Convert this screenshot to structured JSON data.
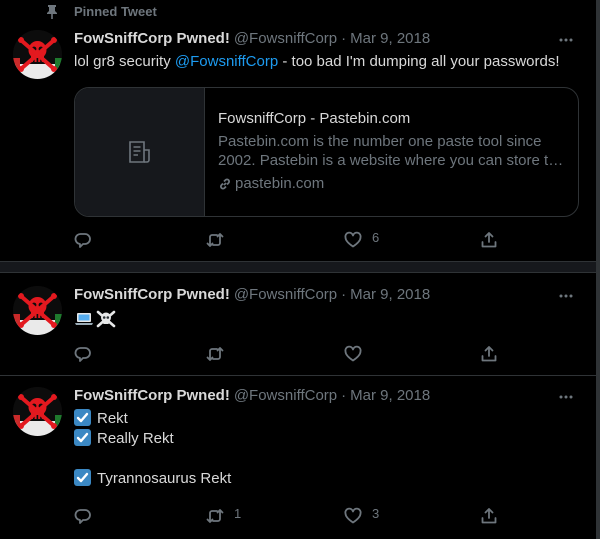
{
  "pinned_label": "Pinned Tweet",
  "tweets": [
    {
      "display_name": "FowSniffCorp Pwned!",
      "handle": "@FowsniffCorp",
      "date": "Mar 9, 2018",
      "text_before": "lol gr8 security ",
      "mention": "@FowsniffCorp",
      "text_after": " - too bad I'm dumping all your passwords!",
      "card": {
        "title": "FowsniffCorp - Pastebin.com",
        "desc_line1": "Pastebin.com is the number one paste tool since",
        "desc_line2": "2002. Pastebin is a website where you can store t…",
        "link": "pastebin.com"
      },
      "likes": "6"
    },
    {
      "display_name": "FowSniffCorp Pwned!",
      "handle": "@FowsniffCorp",
      "date": "Mar 9, 2018",
      "emoji": [
        "laptop-icon",
        "skull-crossbones-icon"
      ]
    },
    {
      "display_name": "FowSniffCorp Pwned!",
      "handle": "@FowsniffCorp",
      "date": "Mar 9, 2018",
      "lines": [
        "Rekt",
        "Really Rekt",
        "Tyrannosaurus Rekt"
      ],
      "retweets": "1",
      "likes": "3"
    }
  ],
  "colors": {
    "background": "#000000",
    "text": "#d9d9d9",
    "muted": "#6e767d",
    "accent": "#1d9bf0",
    "check": "#3b88c3",
    "avatar_red": "#e3191f"
  }
}
